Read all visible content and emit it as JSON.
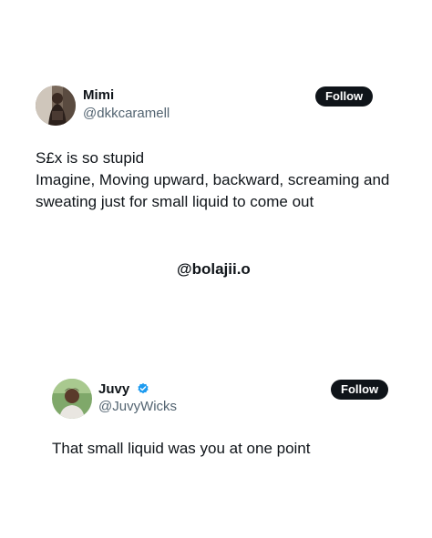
{
  "tweet1": {
    "display_name": "Mimi",
    "handle": "@dkkcaramell",
    "follow_label": "Follow",
    "avatar_icon": "user-photo-avatar",
    "lines": [
      "S£x is so stupid",
      "Imagine, Moving upward, backward, screaming and",
      "sweating just for small liquid to come out"
    ]
  },
  "watermark": "@bolajii.o",
  "tweet2": {
    "display_name": "Juvy",
    "verified": true,
    "verified_icon": "verified-badge-icon",
    "verified_color": "#1d9bf0",
    "handle": "@JuvyWicks",
    "follow_label": "Follow",
    "avatar_icon": "user-photo-avatar",
    "lines": [
      "That small liquid was you at one point"
    ]
  },
  "colors": {
    "text": "#0f1419",
    "muted": "#536471",
    "button_bg": "#0f1419",
    "button_text": "#ffffff",
    "background": "#ffffff"
  }
}
